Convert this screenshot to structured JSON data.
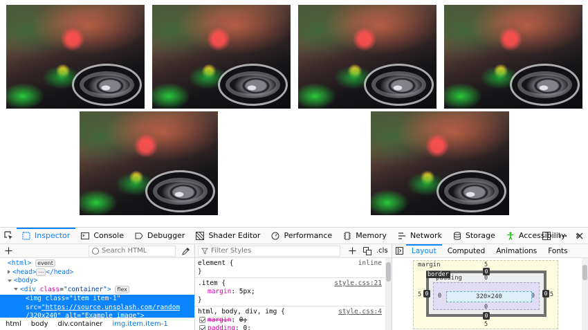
{
  "page": {
    "images": [
      {
        "alt": "Example image"
      },
      {
        "alt": "Example image"
      },
      {
        "alt": "Example image"
      },
      {
        "alt": "Example image"
      },
      {
        "alt": "Example image"
      },
      {
        "alt": "Example image"
      }
    ]
  },
  "devtools": {
    "tabs": [
      {
        "label": "Inspector",
        "icon": "inspector-icon",
        "active": true
      },
      {
        "label": "Console",
        "icon": "console-icon"
      },
      {
        "label": "Debugger",
        "icon": "debugger-icon"
      },
      {
        "label": "Shader Editor",
        "icon": "shader-editor-icon"
      },
      {
        "label": "Performance",
        "icon": "performance-icon"
      },
      {
        "label": "Memory",
        "icon": "memory-icon"
      },
      {
        "label": "Network",
        "icon": "network-icon"
      },
      {
        "label": "Storage",
        "icon": "storage-icon"
      },
      {
        "label": "Accessibility",
        "icon": "accessibility-icon"
      }
    ],
    "more_glyph": "»",
    "markup": {
      "search_placeholder": "Search HTML",
      "lines": {
        "html_open": "<html>",
        "event_badge": "event",
        "head": "<head>",
        "head_dots": "⋯",
        "head_close": "</head>",
        "body_open": "<body>",
        "div_tag": "<div",
        "div_attr": "class",
        "div_val": "\"container\"",
        "div_end": ">",
        "flex_badge": "flex",
        "img_tag": "<img",
        "img_attr1": "class",
        "img_val1": "\"item item-1\"",
        "img_attr2": "src",
        "img_val2a": "\"https://source.unsplash.com/random",
        "img_val2b": "/320x240\"",
        "img_attr3": "alt",
        "img_val3": "\"Example image\"",
        "img_end": ">"
      },
      "breadcrumbs": [
        "html",
        "body",
        "div.container",
        "img.item.item-1"
      ]
    },
    "rules": {
      "filter_placeholder": "Filter Styles",
      "cls_label": ".cls",
      "element": {
        "selector": "element",
        "brace_open": "{",
        "brace_close": "}",
        "source": "inline"
      },
      "item": {
        "selector": ".item",
        "brace_open": "{",
        "source": "style.css:21",
        "prop": "margin",
        "value": "5px;",
        "brace_close": "}"
      },
      "reset": {
        "selector": "html, body, div, img",
        "brace_open": "{",
        "source": "style.css:4",
        "props": [
          {
            "prop": "margin",
            "value": "0;",
            "struck": true
          },
          {
            "prop": "padding",
            "value": "0;",
            "struck": false
          }
        ]
      }
    },
    "layout": {
      "tabs": [
        "Layout",
        "Computed",
        "Animations",
        "Fonts"
      ],
      "active_tab": "Layout",
      "box": {
        "margin_label": "margin",
        "border_label": "border",
        "padding_label": "padding",
        "content": "320×240",
        "margin": {
          "top": "5",
          "right": "5",
          "bottom": "5",
          "left": "5"
        },
        "border": {
          "top": "0",
          "right": "0",
          "bottom": "0",
          "left": "0"
        },
        "padding": {
          "top": "0",
          "right": "0",
          "bottom": "0",
          "left": "0"
        }
      }
    }
  }
}
